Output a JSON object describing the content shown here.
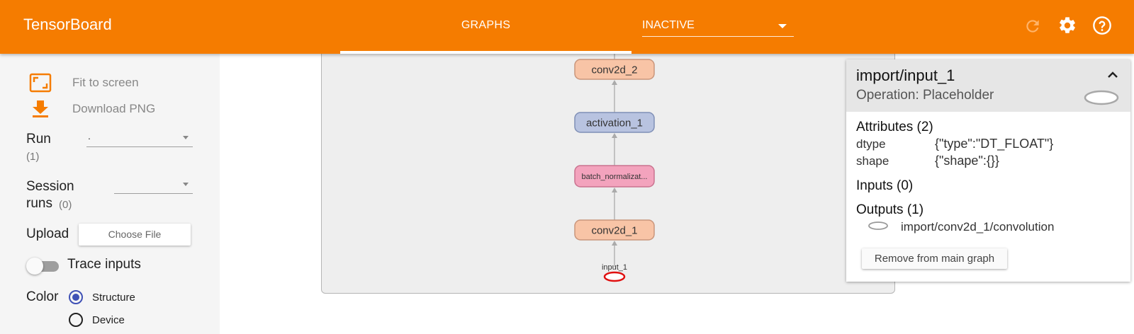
{
  "app": {
    "title": "TensorBoard"
  },
  "header": {
    "tab_label": "GRAPHS",
    "run_select_value": "INACTIVE",
    "icons": [
      "reload-icon",
      "gear-icon",
      "help-icon"
    ]
  },
  "sidebar": {
    "fit_label": "Fit to screen",
    "download_label": "Download PNG",
    "run_label": "Run",
    "run_count": "(1)",
    "run_value": ".",
    "session_label_1": "Session",
    "session_label_2": "runs",
    "session_count": "(0)",
    "session_value": "",
    "upload_label": "Upload",
    "choose_file_label": "Choose File",
    "trace_label": "Trace inputs",
    "trace_enabled": false,
    "color_label": "Color",
    "color_options": [
      {
        "label": "Structure",
        "selected": true
      },
      {
        "label": "Device",
        "selected": false
      }
    ]
  },
  "graph": {
    "nodes": [
      {
        "id": "conv2d_2",
        "label": "conv2d_2",
        "kind": "conv"
      },
      {
        "id": "activation_1",
        "label": "activation_1",
        "kind": "activation"
      },
      {
        "id": "batch_norm",
        "label": "batch_normalizat...",
        "kind": "batchnorm"
      },
      {
        "id": "conv2d_1",
        "label": "conv2d_1",
        "kind": "conv"
      },
      {
        "id": "input_1",
        "label": "input_1",
        "kind": "placeholder",
        "selected": true
      }
    ],
    "colors": {
      "conv": "#f8c4a6",
      "conv_border": "#c9957b",
      "activation": "#b8c3e0",
      "activation_border": "#7f8fb6",
      "batchnorm": "#f3a3bd",
      "batchnorm_border": "#c9738f",
      "selected": "#e01010",
      "edge": "#aaaaaa"
    }
  },
  "info_card": {
    "title": "import/input_1",
    "subtitle": "Operation: Placeholder",
    "attributes_label": "Attributes (2)",
    "attributes": [
      {
        "key": "dtype",
        "value": "{\"type\":\"DT_FLOAT\"}"
      },
      {
        "key": "shape",
        "value": "{\"shape\":{}}"
      }
    ],
    "inputs_label": "Inputs (0)",
    "outputs_label": "Outputs (1)",
    "outputs": [
      {
        "name": "import/conv2d_1/convolution"
      }
    ],
    "remove_button_label": "Remove from main graph"
  }
}
